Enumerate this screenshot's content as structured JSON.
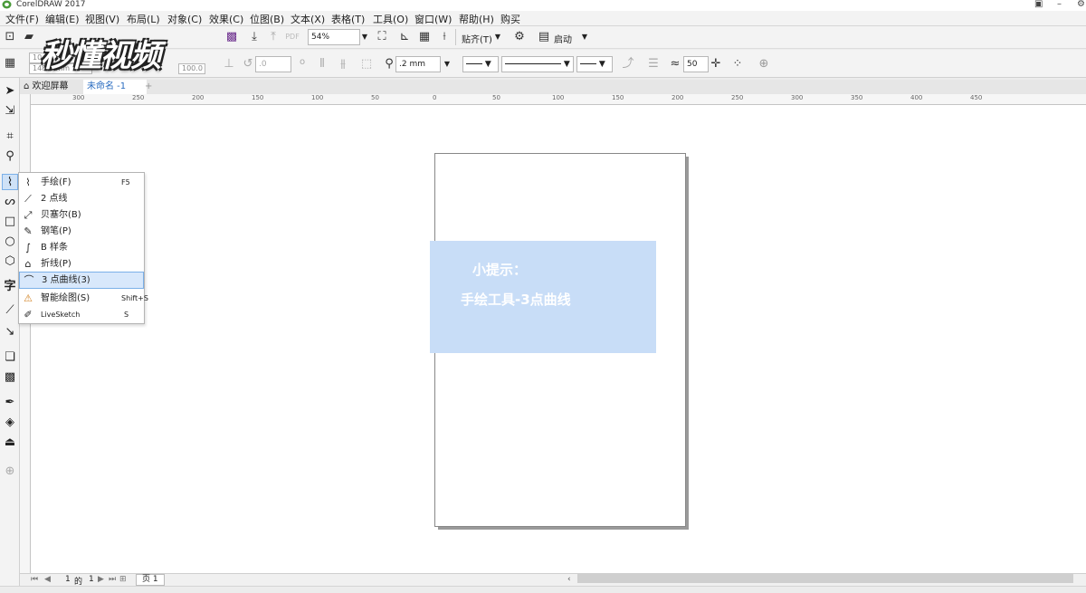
{
  "window": {
    "title": "CorelDRAW 2017"
  },
  "menubar": {
    "items": [
      "文件(F)",
      "编辑(E)",
      "视图(V)",
      "布局(L)",
      "对象(C)",
      "效果(C)",
      "位图(B)",
      "文本(X)",
      "表格(T)",
      "工具(O)",
      "窗口(W)",
      "帮助(H)",
      "购买"
    ]
  },
  "toolbar": {
    "zoom": "54%",
    "snap_label": "贴齐(T)",
    "launch_label": "启动"
  },
  "propertybar": {
    "width_partial": "10",
    "height_partial": "148.5 mm",
    "scale": "100.0",
    "angle": ".0",
    "outline_width": ".2 mm",
    "smoothing": "50"
  },
  "tabs": {
    "welcome": "欢迎屏幕",
    "document": "未命名 -1"
  },
  "ruler": {
    "top_ticks": [
      "300",
      "250",
      "200",
      "150",
      "100",
      "50",
      "0",
      "50",
      "100",
      "150",
      "200",
      "250",
      "300",
      "350",
      "400",
      "450"
    ]
  },
  "flyout": {
    "items": [
      {
        "icon": "freehand-icon",
        "label": "手绘(F)",
        "shortcut": "F5"
      },
      {
        "icon": "two-point-line-icon",
        "label": "2 点线",
        "shortcut": ""
      },
      {
        "icon": "bezier-icon",
        "label": "贝塞尔(B)",
        "shortcut": ""
      },
      {
        "icon": "pen-icon",
        "label": "钢笔(P)",
        "shortcut": ""
      },
      {
        "icon": "b-spline-icon",
        "label": "B 样条",
        "shortcut": ""
      },
      {
        "icon": "polyline-icon",
        "label": "折线(P)",
        "shortcut": ""
      },
      {
        "icon": "three-point-curve-icon",
        "label": "3 点曲线(3)",
        "shortcut": ""
      },
      {
        "icon": "smart-drawing-icon",
        "label": "智能绘图(S)",
        "shortcut": "Shift+S"
      },
      {
        "icon": "livesketch-icon",
        "label": "LiveSketch",
        "shortcut": "S"
      }
    ],
    "selected_index": 6
  },
  "tip": {
    "line1": "小提示：",
    "line2": "手绘工具-3点曲线"
  },
  "statusbar": {
    "page_current": "1",
    "page_of": "的",
    "page_total": "1",
    "page_tab": "页 1"
  },
  "watermark": {
    "text": "秒懂视频"
  },
  "colors": {
    "tip_bg": "#c8ddf7",
    "selection_bg": "#d8e8fb",
    "selection_border": "#7bb0e8"
  }
}
